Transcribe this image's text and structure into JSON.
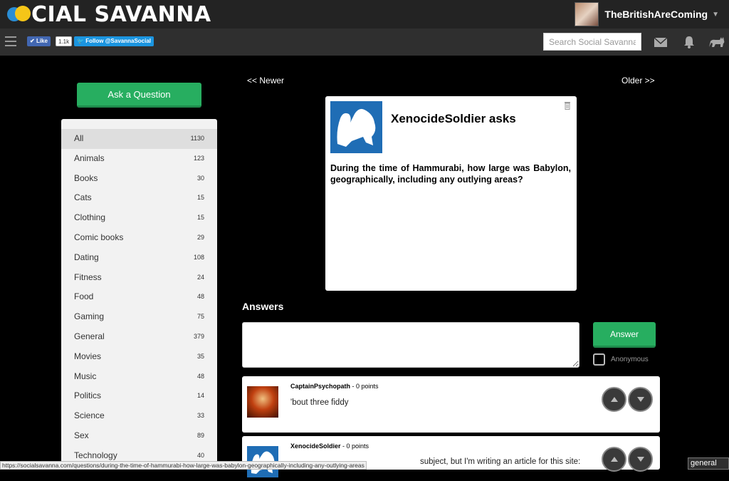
{
  "header": {
    "logo_text": "CIAL SAVANNA",
    "user_name": "TheBritishAreComing"
  },
  "toolbar": {
    "like_label": "Like",
    "like_count": "1.1k",
    "follow_label": "Follow @SavannaSocial",
    "search_placeholder": "Search Social Savanna"
  },
  "nav": {
    "newer": "<< Newer",
    "older": "Older >>"
  },
  "ask_button": "Ask a Question",
  "categories": [
    {
      "label": "All",
      "count": "1130"
    },
    {
      "label": "Animals",
      "count": "123"
    },
    {
      "label": "Books",
      "count": "30"
    },
    {
      "label": "Cats",
      "count": "15"
    },
    {
      "label": "Clothing",
      "count": "15"
    },
    {
      "label": "Comic books",
      "count": "29"
    },
    {
      "label": "Dating",
      "count": "108"
    },
    {
      "label": "Fitness",
      "count": "24"
    },
    {
      "label": "Food",
      "count": "48"
    },
    {
      "label": "Gaming",
      "count": "75"
    },
    {
      "label": "General",
      "count": "379"
    },
    {
      "label": "Movies",
      "count": "35"
    },
    {
      "label": "Music",
      "count": "48"
    },
    {
      "label": "Politics",
      "count": "14"
    },
    {
      "label": "Science",
      "count": "33"
    },
    {
      "label": "Sex",
      "count": "89"
    },
    {
      "label": "Technology",
      "count": "40"
    }
  ],
  "question": {
    "title": "XenocideSoldier asks",
    "text": "During the time of Hammurabi, how large was Babylon, geographically, including any outlying areas?"
  },
  "answers_heading": "Answers",
  "answer_button": "Answer",
  "anonymous_label": "Anonymous",
  "answers": [
    {
      "author": "CaptainPsychopath",
      "points": " - 0 points",
      "text": "'bout three fiddy"
    },
    {
      "author": "XenocideSoldier",
      "points": " - 0 points",
      "text": "subject, but I'm writing an article for this site:"
    }
  ],
  "status_url": "https://socialsavanna.com/questions/during-the-time-of-hammurabi-how-large-was-babylon-geographically-including-any-outlying-areas",
  "general_tag": "general"
}
